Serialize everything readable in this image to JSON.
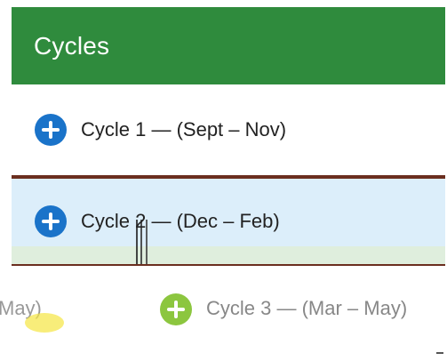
{
  "panel": {
    "title": "Cycles"
  },
  "cycles": [
    {
      "label": "Cycle 1 — (Sept – Nov)",
      "expanded": false,
      "icon": "plus-circle-icon"
    },
    {
      "label": "Cycle 2 — (Dec – Feb)",
      "expanded": false,
      "icon": "plus-circle-icon"
    },
    {
      "label": "Cycle 3 — (Mar – May)",
      "expanded": false,
      "icon": "plus-circle-icon"
    }
  ],
  "ghost_left_text": "May)",
  "colors": {
    "header_bg": "#2f8b3d",
    "header_text": "#ffffff",
    "icon_blue": "#1a73c9",
    "icon_green": "#8cc63f",
    "active_row_bg": "#dceefa",
    "divider": "#6b2e1f"
  }
}
